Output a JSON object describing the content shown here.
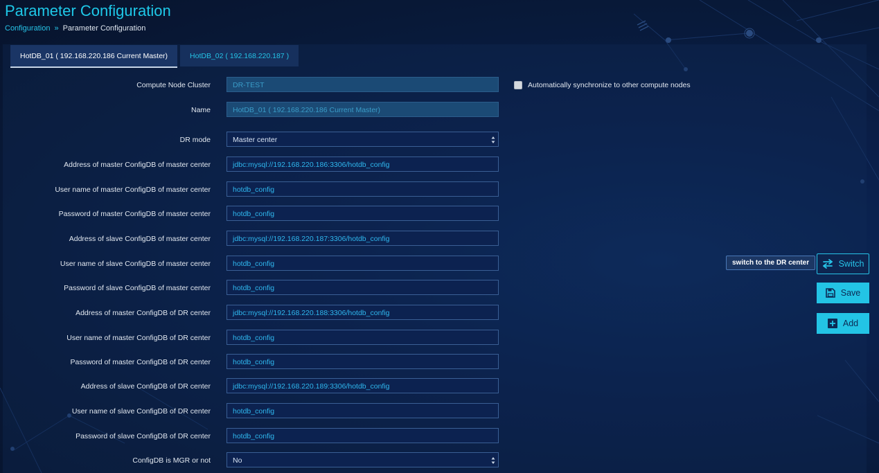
{
  "page": {
    "title": "Parameter Configuration"
  },
  "breadcrumb": {
    "link": "Configuration",
    "separator": "»",
    "current": "Parameter Configuration"
  },
  "tabs": [
    {
      "label": "HotDB_01 ( 192.168.220.186 Current Master)",
      "active": true
    },
    {
      "label": "HotDB_02  ( 192.168.220.187 )",
      "active": false
    }
  ],
  "form": {
    "compute_node_cluster": {
      "label": "Compute Node Cluster",
      "value": "DR-TEST"
    },
    "name": {
      "label": "Name",
      "value": "HotDB_01 ( 192.168.220.186 Current Master)"
    },
    "dr_mode": {
      "label": "DR mode",
      "value": "Master center"
    },
    "master_addr_master": {
      "label": "Address of master ConfigDB of master center",
      "value": "jdbc:mysql://192.168.220.186:3306/hotdb_config"
    },
    "master_user_master": {
      "label": "User name of master ConfigDB of master center",
      "value": "hotdb_config"
    },
    "master_pass_master": {
      "label": "Password of master ConfigDB of master center",
      "value": "hotdb_config"
    },
    "slave_addr_master": {
      "label": "Address of slave ConfigDB of master center",
      "value": "jdbc:mysql://192.168.220.187:3306/hotdb_config"
    },
    "slave_user_master": {
      "label": "User name of slave ConfigDB of master center",
      "value": "hotdb_config"
    },
    "slave_pass_master": {
      "label": "Password of slave ConfigDB of master center",
      "value": "hotdb_config"
    },
    "master_addr_dr": {
      "label": "Address of master ConfigDB of DR center",
      "value": "jdbc:mysql://192.168.220.188:3306/hotdb_config"
    },
    "master_user_dr": {
      "label": "User name of master ConfigDB of DR center",
      "value": "hotdb_config"
    },
    "master_pass_dr": {
      "label": "Password of master ConfigDB of DR center",
      "value": "hotdb_config"
    },
    "slave_addr_dr": {
      "label": "Address of slave ConfigDB of DR center",
      "value": "jdbc:mysql://192.168.220.189:3306/hotdb_config"
    },
    "slave_user_dr": {
      "label": "User name of slave ConfigDB of DR center",
      "value": "hotdb_config"
    },
    "slave_pass_dr": {
      "label": "Password of slave ConfigDB of DR center",
      "value": "hotdb_config"
    },
    "configdb_mgr": {
      "label": "ConfigDB is MGR or not",
      "value": "No"
    }
  },
  "sync_checkbox": {
    "label": "Automatically synchronize to other compute nodes",
    "checked": false
  },
  "actions": {
    "switch_tooltip": "switch to the DR center",
    "switch_label": "Switch",
    "save_label": "Save",
    "add_label": "Add"
  },
  "colors": {
    "accent": "#1ec8e8",
    "background": "#0a1f4a",
    "button_fill": "#23c4e5"
  }
}
